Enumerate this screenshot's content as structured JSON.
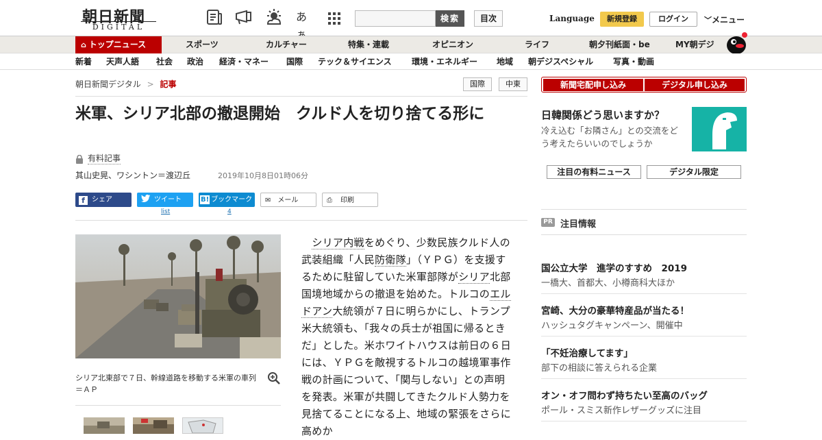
{
  "header": {
    "logo_ja": "朝日新聞",
    "logo_en": "DIGITAL",
    "icons": [
      "newspaper-icon",
      "megaphone-icon",
      "weather-icon",
      "font-size-icon",
      "apps-grid-icon"
    ],
    "font_size_label": "あぁ",
    "search_button": "検索",
    "toc_button": "目次",
    "language": "Language",
    "register": "新規登録",
    "login": "ログイン",
    "menu": "メニュー"
  },
  "nav_primary": [
    "トップニュース",
    "スポーツ",
    "カルチャー",
    "特集・連載",
    "オピニオン",
    "ライフ",
    "朝夕刊紙面・be",
    "MY朝デジ"
  ],
  "nav_secondary": [
    "新着",
    "天声人語",
    "社会",
    "政治",
    "経済・マネー",
    "国際",
    "テック＆サイエンス",
    "環境・エネルギー",
    "地域",
    "朝デジスペシャル",
    "写真・動画"
  ],
  "breadcrumb": {
    "home": "朝日新聞デジタル",
    "sep": ">",
    "current": "記事"
  },
  "tags": [
    "国際",
    "中東"
  ],
  "article": {
    "headline": "米軍、シリア北部の撤退開始　クルド人を切り捨てる形に",
    "paid_label": "有料記事",
    "byline": "其山史晃、ワシントン＝渡辺丘",
    "date": "2019年10月8日01時06分",
    "share": {
      "facebook": "シェア",
      "twitter": "ツイート",
      "hatena": "ブックマーク",
      "hatena_badge": "B!",
      "mail": "メール",
      "print": "印刷",
      "twitter_count": "list",
      "hatena_count": "4"
    },
    "photo_caption": "シリア北東部で７日、幹線道路を移動する米軍の車列＝ＡＰ",
    "body": {
      "p1_a": "シリア内戦",
      "p1_b": "をめぐり、少数民族クルド人の武装組織「人民",
      "p1_c": "防衛隊",
      "p1_d": "」（ＹＰＧ）を支援するために駐留していた米軍部隊が",
      "p1_e": "シリア",
      "p1_f": "北部国境地域からの撤退を始めた。トルコの",
      "p1_g": "エルドアン",
      "p1_h": "大統領が７日に明らかにし、トランプ米大統領も、「我々の兵士が祖国に帰るときだ」とした。米ホワイトハウスは前日の６日には、ＹＰＧを敵視するトルコの越境軍事作戦の計画について、「関与しない」との声明を発表。米軍が共闘してきたクルド人勢力を見捨てることになる上、地域の緊張をさらに高めか"
    }
  },
  "sidebar": {
    "subscribe_news": "新聞宅配申し込み",
    "subscribe_digital": "デジタル申し込み",
    "ad": {
      "title": "日韓関係どう思いますか？",
      "text": "冷え込む「お隣さん」との交流をどう考えたらいいのでしょうか"
    },
    "pick_paid": "注目の有料ニュース",
    "pick_digital": "デジタル限定",
    "pr_badge": "PR",
    "pr_title": "注目情報",
    "pr_items": [
      {
        "title": "国公立大学　進学のすすめ　2019",
        "sub": "一橋大、首都大、小樽商科大ほか"
      },
      {
        "title": "宮崎、大分の豪華特産品が当たる！",
        "sub": "ハッシュタグキャンペーン、開催中"
      },
      {
        "title": "「不妊治療してます」",
        "sub": "部下の相談に答えられる企業"
      },
      {
        "title": "オン・オフ問わず持ちたい至高のバッグ",
        "sub": "ポール・スミス新作レザーグッズに注目"
      }
    ]
  },
  "colors": {
    "brand_red": "#bb0000",
    "register_yellow": "#f2c94c",
    "facebook_navy": "#2d4a8a",
    "twitter_blue": "#1da1f2",
    "hatena_blue": "#0d8bd1",
    "ad_teal": "#16b3a6"
  }
}
